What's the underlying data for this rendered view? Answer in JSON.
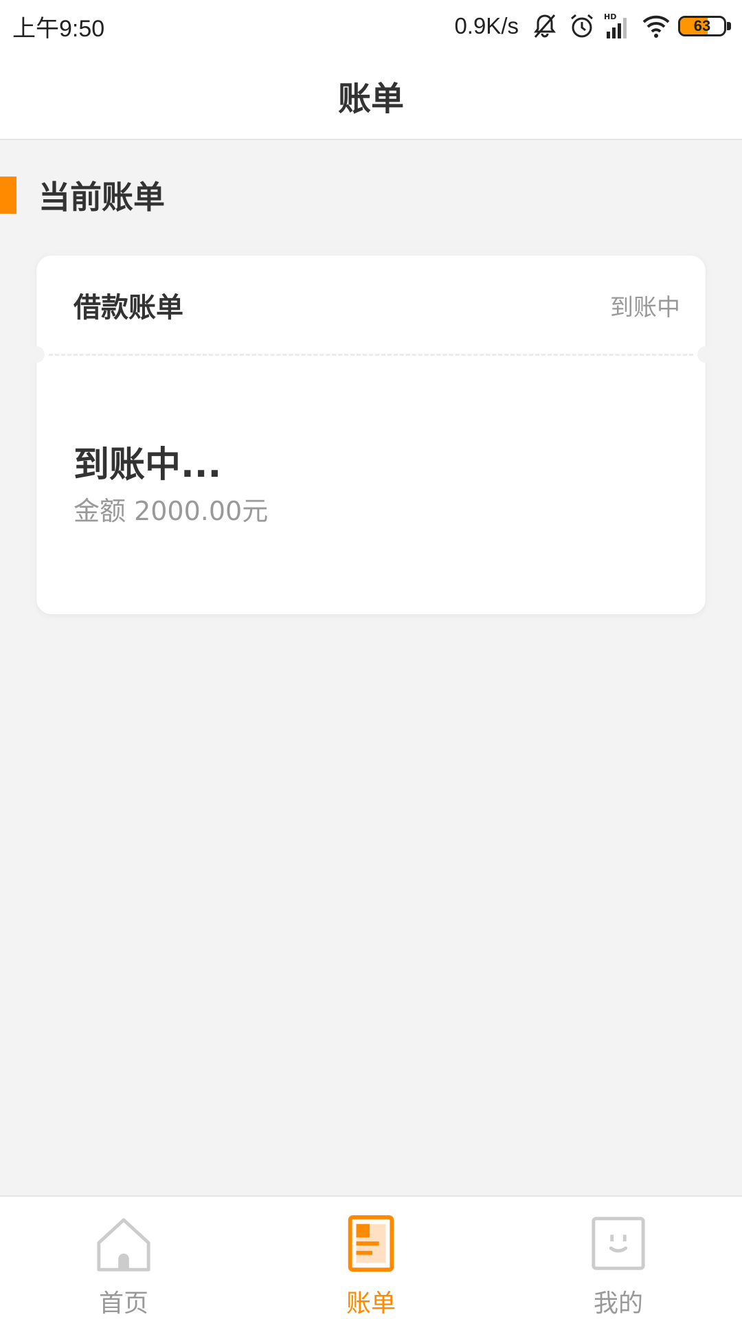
{
  "status_bar": {
    "time": "上午9:50",
    "net_speed": "0.9K/s",
    "battery_level": 63,
    "battery_label": "63",
    "icons": [
      "bell-off-icon",
      "alarm-icon",
      "hd-signal-icon",
      "wifi-icon",
      "battery-icon"
    ]
  },
  "header": {
    "title": "账单"
  },
  "section": {
    "title": "当前账单"
  },
  "bill_card": {
    "title": "借款账单",
    "status_tag": "到账中",
    "main_status": "到账中...",
    "amount_text": "金额 2000.00元"
  },
  "bottom_nav": {
    "items": [
      {
        "label": "首页",
        "icon": "home-icon",
        "active": false
      },
      {
        "label": "账单",
        "icon": "bill-icon",
        "active": true
      },
      {
        "label": "我的",
        "icon": "profile-icon",
        "active": false
      }
    ]
  },
  "colors": {
    "accent": "#ff8a00",
    "background": "#f3f3f3",
    "text_primary": "#333333",
    "text_secondary": "#999999"
  }
}
